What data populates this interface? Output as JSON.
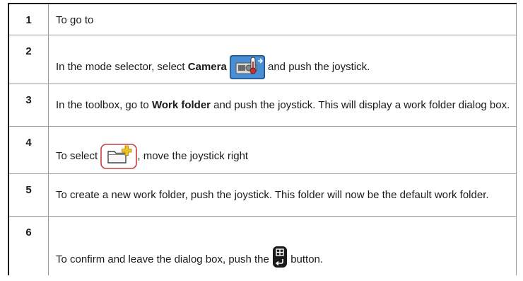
{
  "steps": [
    {
      "num": "1",
      "text": "To go to"
    },
    {
      "num": "2",
      "text_before": "In the mode selector, select ",
      "bold": "Camera",
      "text_after": " and push the joystick.",
      "icon": "camera-thermometer-icon"
    },
    {
      "num": "3",
      "text_before": "In the toolbox, go to ",
      "bold": "Work folder",
      "text_after": " and push the joystick. This will display a work folder dialog box."
    },
    {
      "num": "4",
      "text_before": "To select ",
      "text_after": ", move the joystick right",
      "icon": "new-folder-icon"
    },
    {
      "num": "5",
      "text": "To create a new work folder, push the joystick. This folder will now be the default work folder."
    },
    {
      "num": "6",
      "text_before": "To confirm and leave the dialog box, push the ",
      "text_after": " button.",
      "icon": "back-button-icon"
    }
  ]
}
